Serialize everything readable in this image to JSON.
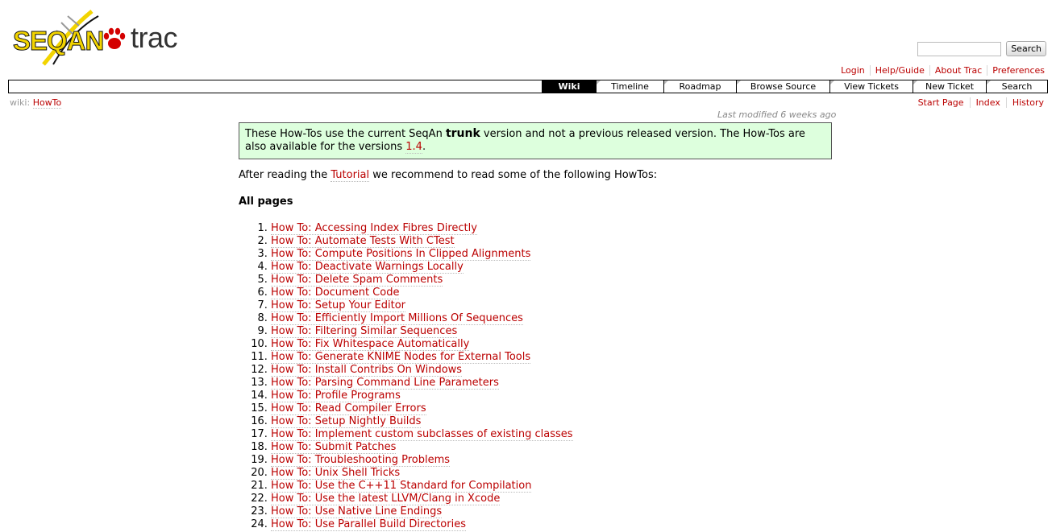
{
  "logo": {
    "brand": "SEQAN",
    "product": "trac"
  },
  "search": {
    "value": "",
    "button_label": "Search"
  },
  "metanav": [
    "Login",
    "Help/Guide",
    "About Trac",
    "Preferences"
  ],
  "mainnav": {
    "items": [
      {
        "label": "Wiki",
        "width": 66
      },
      {
        "label": "Timeline",
        "width": 83
      },
      {
        "label": "Roadmap",
        "width": 89
      },
      {
        "label": "Browse Source",
        "width": 115
      },
      {
        "label": "View Tickets",
        "width": 102
      },
      {
        "label": "New Ticket",
        "width": 90
      },
      {
        "label": "Search",
        "width": 75
      }
    ],
    "active": "Wiki"
  },
  "breadcrumb": {
    "prefix": "wiki:",
    "page": "HowTo"
  },
  "ctxnav": [
    "Start Page",
    "Index",
    "History"
  ],
  "last_modified": "Last modified 6 weeks ago",
  "notice": {
    "text_before": "These How-Tos use the current SeqAn ",
    "strong": "trunk",
    "text_middle": " version and not a previous released version. The How-Tos are also available for the versions ",
    "version_link": "1.4",
    "text_after": "."
  },
  "intro": {
    "before": "After reading the ",
    "link": "Tutorial",
    "after": " we recommend to read some of the following HowTos:"
  },
  "section_title": "All pages",
  "howtos": [
    "How To: Accessing Index Fibres Directly",
    "How To: Automate Tests With CTest",
    "How To: Compute Positions In Clipped Alignments",
    "How To: Deactivate Warnings Locally",
    "How To: Delete Spam Comments",
    "How To: Document Code",
    "How To: Setup Your Editor",
    "How To: Efficiently Import Millions Of Sequences",
    "How To: Filtering Similar Sequences",
    "How To: Fix Whitespace Automatically",
    "How To: Generate KNIME Nodes for External Tools",
    "How To: Install Contribs On Windows",
    "How To: Parsing Command Line Parameters",
    "How To: Profile Programs",
    "How To: Read Compiler Errors",
    "How To: Setup Nightly Builds",
    "How To: Implement custom subclasses of existing classes",
    "How To: Submit Patches",
    "How To: Troubleshooting Problems",
    "How To: Unix Shell Tricks",
    "How To: Use the C++11 Standard for Compilation",
    "How To: Use the latest LLVM/Clang in Xcode",
    "How To: Use Native Line Endings",
    "How To: Use Parallel Build Directories"
  ]
}
